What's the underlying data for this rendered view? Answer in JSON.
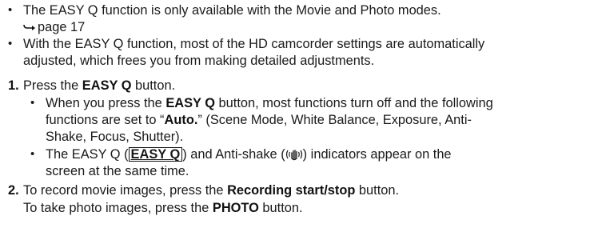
{
  "intro": {
    "b1_line1": "The EASY Q function is only available with the Movie and Photo modes.",
    "b1_ref": "page 17",
    "b2_line1": "With the EASY Q function, most of the HD camcorder settings are automatically",
    "b2_line2": "adjusted, which frees you from making detailed adjustments."
  },
  "steps": {
    "s1_num": "1.",
    "s1_pre": "Press the ",
    "s1_bold": "EASY Q",
    "s1_post": " button.",
    "sub1_l1_pre": "When you press the ",
    "sub1_l1_bold": "EASY Q",
    "sub1_l1_post": " button, most functions turn off and the following",
    "sub1_l2_pre": "functions are set to “",
    "sub1_l2_bold": "Auto.",
    "sub1_l2_post": "” (Scene Mode, White Balance, Exposure, Anti-",
    "sub1_l3": "Shake, Focus, Shutter).",
    "sub2_l1_pre": "The EASY Q (",
    "sub2_l1_box": "EASY Q",
    "sub2_l1_mid": ") and Anti-shake (",
    "sub2_l1_post": ") indicators appear on the",
    "sub2_l2": "screen at the same time.",
    "s2_num": "2.",
    "s2_pre": "To record movie images, press the ",
    "s2_bold": "Recording start/stop",
    "s2_post": " button.",
    "s2_l2_pre": "To take photo images, press the ",
    "s2_l2_bold": "PHOTO",
    "s2_l2_post": " button."
  },
  "icons": {
    "bullet": "•",
    "page_ref_arrow": "arrow-right-icon",
    "antishake": "anti-shake-hand-icon"
  }
}
